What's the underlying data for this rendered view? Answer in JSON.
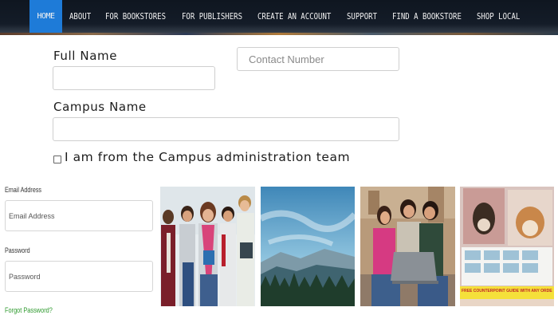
{
  "nav": {
    "items": [
      "HOME",
      "ABOUT",
      "FOR BOOKSTORES",
      "FOR PUBLISHERS",
      "CREATE AN ACCOUNT",
      "SUPPORT",
      "FIND A BOOKSTORE",
      "SHOP LOCAL"
    ],
    "active": "HOME",
    "active_color": "#1e7bd8"
  },
  "form": {
    "full_name_label": "Full Name",
    "full_name_value": "",
    "contact_number_placeholder": "Contact Number",
    "campus_name_label": "Campus Name",
    "campus_name_value": "",
    "admin_checkbox_label": "I am from the Campus administration team",
    "admin_checkbox_checked": false
  },
  "login": {
    "email_label": "Email Address",
    "email_placeholder": "Email Address",
    "password_label": "Password",
    "password_placeholder": "Password",
    "forgot_link": "Forgot Password?",
    "link_color": "#2e9a2e"
  },
  "gallery": {
    "banner_text": "FREE COUNTERPOINT GUIDE WITH ANY ORDER CALENDAR"
  }
}
